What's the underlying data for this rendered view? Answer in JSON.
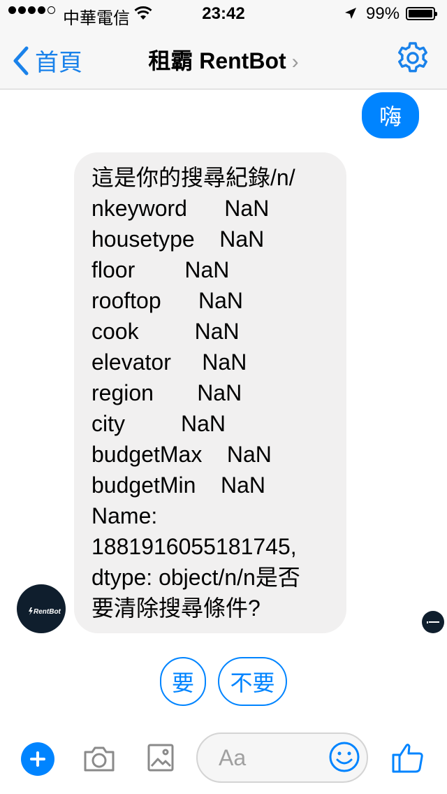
{
  "status_bar": {
    "carrier": "中華電信",
    "time": "23:42",
    "battery_percent": "99%"
  },
  "nav": {
    "back_label": "首頁",
    "title": "租霸 RentBot",
    "title_arrow": "›"
  },
  "messages": {
    "outgoing_text": "嗨",
    "incoming_lines": [
      "這是你的搜尋紀錄/n/",
      "nkeyword      NaN",
      "housetype    NaN",
      "floor        NaN",
      "rooftop      NaN",
      "cook         NaN",
      "elevator     NaN",
      "region       NaN",
      "city         NaN",
      "budgetMax    NaN",
      "budgetMin    NaN",
      "Name:",
      "1881916055181745,",
      "dtype: object/n/n是否",
      "要清除搜尋條件?"
    ],
    "avatar_text": "RentBot"
  },
  "quick_replies": [
    "要",
    "不要"
  ],
  "composer": {
    "placeholder": "Aa"
  },
  "colors": {
    "accent": "#0084ff",
    "incoming_bubble": "#f1f0f0",
    "avatar_bg": "#0f1e2d"
  },
  "icons": [
    "signal-dots-icon",
    "wifi-icon",
    "location-arrow-icon",
    "battery-icon",
    "back-chevron-icon",
    "gear-icon",
    "plus-icon",
    "camera-icon",
    "gallery-icon",
    "smiley-icon",
    "thumbs-up-icon"
  ]
}
